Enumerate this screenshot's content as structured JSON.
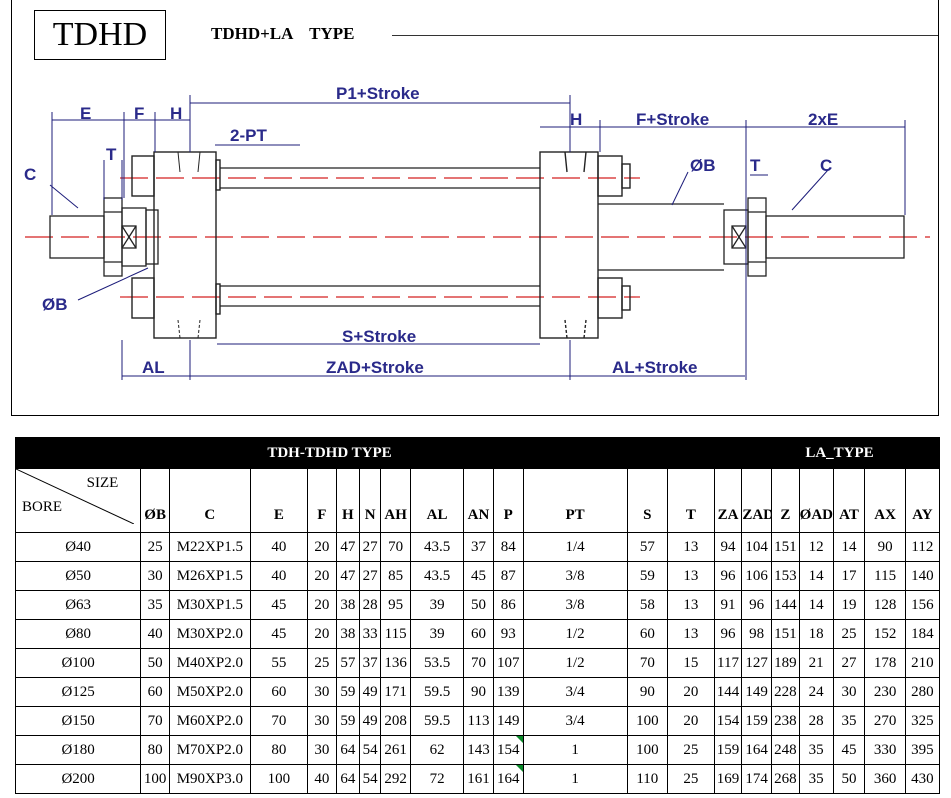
{
  "header": {
    "logo": "TDHD",
    "type_title": "TDHD+LA    TYPE"
  },
  "drawing_labels": {
    "E": "E",
    "F": "F",
    "H_left": "H",
    "P1": "P1+Stroke",
    "PT": "2-PT",
    "H_right": "H",
    "F_stroke": "F+Stroke",
    "two_E": "2xE",
    "T_left": "T",
    "T_right": "T",
    "C_left": "C",
    "C_right": "C",
    "OB_right": "ØB",
    "OB_left": "ØB",
    "S": "S+Stroke",
    "AL": "AL",
    "ZAD": "ZAD+Stroke",
    "AL_stroke": "AL+Stroke"
  },
  "table": {
    "band_left": "TDH-TDHD TYPE",
    "band_right": "LA_TYPE",
    "corner_size": "SIZE",
    "corner_bore": "BORE",
    "columns": [
      "ØB",
      "C",
      "E",
      "F",
      "H",
      "N",
      "AH",
      "AL",
      "AN",
      "P",
      "PT",
      "S",
      "T",
      "ZA",
      "ZAD",
      "Z",
      "ØAD",
      "AT",
      "AX",
      "AY"
    ],
    "rows": [
      [
        "Ø40",
        "25",
        "M22XP1.5",
        "40",
        "20",
        "47",
        "27",
        "70",
        "43.5",
        "37",
        "84",
        "1/4",
        "57",
        "13",
        "94",
        "104",
        "151",
        "12",
        "14",
        "90",
        "112"
      ],
      [
        "Ø50",
        "30",
        "M26XP1.5",
        "40",
        "20",
        "47",
        "27",
        "85",
        "43.5",
        "45",
        "87",
        "3/8",
        "59",
        "13",
        "96",
        "106",
        "153",
        "14",
        "17",
        "115",
        "140"
      ],
      [
        "Ø63",
        "35",
        "M30XP1.5",
        "45",
        "20",
        "38",
        "28",
        "95",
        "39",
        "50",
        "86",
        "3/8",
        "58",
        "13",
        "91",
        "96",
        "144",
        "14",
        "19",
        "128",
        "156"
      ],
      [
        "Ø80",
        "40",
        "M30XP2.0",
        "45",
        "20",
        "38",
        "33",
        "115",
        "39",
        "60",
        "93",
        "1/2",
        "60",
        "13",
        "96",
        "98",
        "151",
        "18",
        "25",
        "152",
        "184"
      ],
      [
        "Ø100",
        "50",
        "M40XP2.0",
        "55",
        "25",
        "57",
        "37",
        "136",
        "53.5",
        "70",
        "107",
        "1/2",
        "70",
        "15",
        "117",
        "127",
        "189",
        "21",
        "27",
        "178",
        "210"
      ],
      [
        "Ø125",
        "60",
        "M50XP2.0",
        "60",
        "30",
        "59",
        "49",
        "171",
        "59.5",
        "90",
        "139",
        "3/4",
        "90",
        "20",
        "144",
        "149",
        "228",
        "24",
        "30",
        "230",
        "280"
      ],
      [
        "Ø150",
        "70",
        "M60XP2.0",
        "70",
        "30",
        "59",
        "49",
        "208",
        "59.5",
        "113",
        "149",
        "3/4",
        "100",
        "20",
        "154",
        "159",
        "238",
        "28",
        "35",
        "270",
        "325"
      ],
      [
        "Ø180",
        "80",
        "M70XP2.0",
        "80",
        "30",
        "64",
        "54",
        "261",
        "62",
        "143",
        "154",
        "1",
        "100",
        "25",
        "159",
        "164",
        "248",
        "35",
        "45",
        "330",
        "395"
      ],
      [
        "Ø200",
        "100",
        "M90XP3.0",
        "100",
        "40",
        "64",
        "54",
        "292",
        "72",
        "161",
        "164",
        "1",
        "110",
        "25",
        "169",
        "174",
        "268",
        "35",
        "50",
        "360",
        "430"
      ]
    ]
  },
  "colors": {
    "dimension_text": "#2a2a8a",
    "centerline": "#d42020",
    "flag": "#0a8a2a"
  }
}
